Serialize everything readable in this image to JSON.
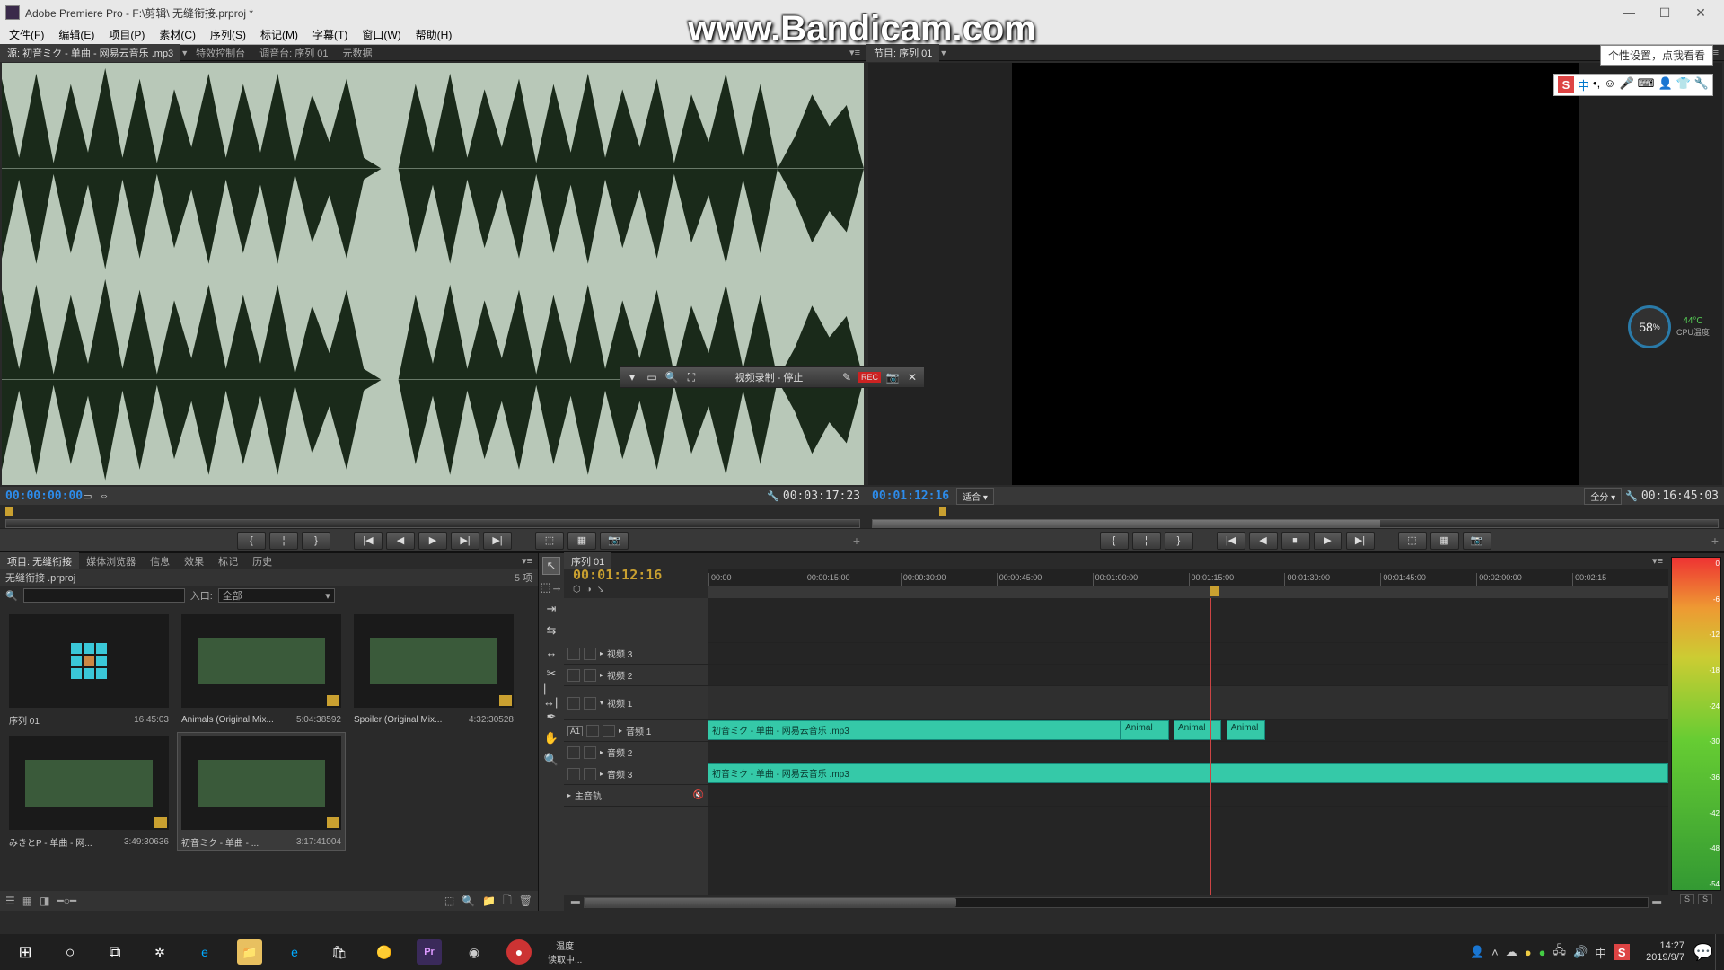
{
  "window": {
    "title": "Adobe Premiere Pro - F:\\剪辑\\ 无缝衔接.prproj *"
  },
  "menus": [
    "文件(F)",
    "编辑(E)",
    "项目(P)",
    "素材(C)",
    "序列(S)",
    "标记(M)",
    "字幕(T)",
    "窗口(W)",
    "帮助(H)"
  ],
  "watermark": "www.Bandicam.com",
  "source_tabs": {
    "active": "源: 初音ミク - 单曲 - 网易云音乐 .mp3",
    "others": [
      "特效控制台",
      "调音台: 序列 01",
      "元数据"
    ]
  },
  "program_tabs": {
    "active": "节目: 序列 01"
  },
  "source": {
    "tc_in": "00:00:00:00",
    "tc_dur": "00:03:17:23"
  },
  "program": {
    "tc": "00:01:12:16",
    "fit": "适合",
    "full": "全分",
    "dur": "00:16:45:03"
  },
  "transport_icons": [
    "{",
    "|",
    "}",
    "|◀",
    "◀",
    "▶",
    "▶|",
    "▶|",
    "⎘",
    "⎌",
    "📷"
  ],
  "bandicam": {
    "text": "视频录制 - 停止",
    "rec": "REC"
  },
  "ime_tooltip": "个性设置，点我看看",
  "temp": {
    "pct": "58",
    "unit": "%",
    "deg": "44°C",
    "label": "CPU温度"
  },
  "project": {
    "tabs": [
      "项目: 无缝衔接",
      "媒体浏览器",
      "信息",
      "效果",
      "标记",
      "历史"
    ],
    "breadcrumb": "无缝衔接 .prproj",
    "count_label": "5 项",
    "filter_label": "入口:",
    "filter_value": "全部",
    "items": [
      {
        "name": "序列 01",
        "dur": "16:45:03",
        "type": "seq"
      },
      {
        "name": "Animals (Original Mix...",
        "dur": "5:04:38592",
        "type": "audio"
      },
      {
        "name": "Spoiler (Original Mix...",
        "dur": "4:32:30528",
        "type": "audio"
      },
      {
        "name": "みきとP - 单曲 - 网...",
        "dur": "3:49:30636",
        "type": "audio"
      },
      {
        "name": "初音ミク - 单曲 - ...",
        "dur": "3:17:41004",
        "type": "audio",
        "sel": true
      }
    ]
  },
  "timeline": {
    "tab": "序列 01",
    "tc": "00:01:12:16",
    "ruler": [
      "00:00",
      "00:00:15:00",
      "00:00:30:00",
      "00:00:45:00",
      "00:01:00:00",
      "00:01:15:00",
      "00:01:30:00",
      "00:01:45:00",
      "00:02:00:00",
      "00:02:15"
    ],
    "tracks": {
      "video3": "视频 3",
      "video2": "视频 2",
      "video1": "视频 1",
      "audio1": "音频 1",
      "audio2": "音频 2",
      "audio3": "音频 3",
      "master": "主音轨"
    },
    "clips": {
      "a1_main": "初音ミク - 单曲 - 网易云音乐 .mp3",
      "a1_b": "Animal",
      "a1_c": "Animal",
      "a1_d": "Animal",
      "a3_main": "初音ミク - 单曲 - 网易云音乐 .mp3"
    },
    "a1_label": "A1"
  },
  "meters": {
    "scale": [
      "0",
      "-6",
      "-12",
      "-18",
      "-24",
      "-30",
      "-36",
      "-42",
      "-48",
      "-54"
    ],
    "s": "S",
    "solo": "S"
  },
  "taskbar": {
    "temp_lbl": "温度",
    "temp_sub": "读取中...",
    "time": "14:27",
    "date": "2019/9/7"
  }
}
